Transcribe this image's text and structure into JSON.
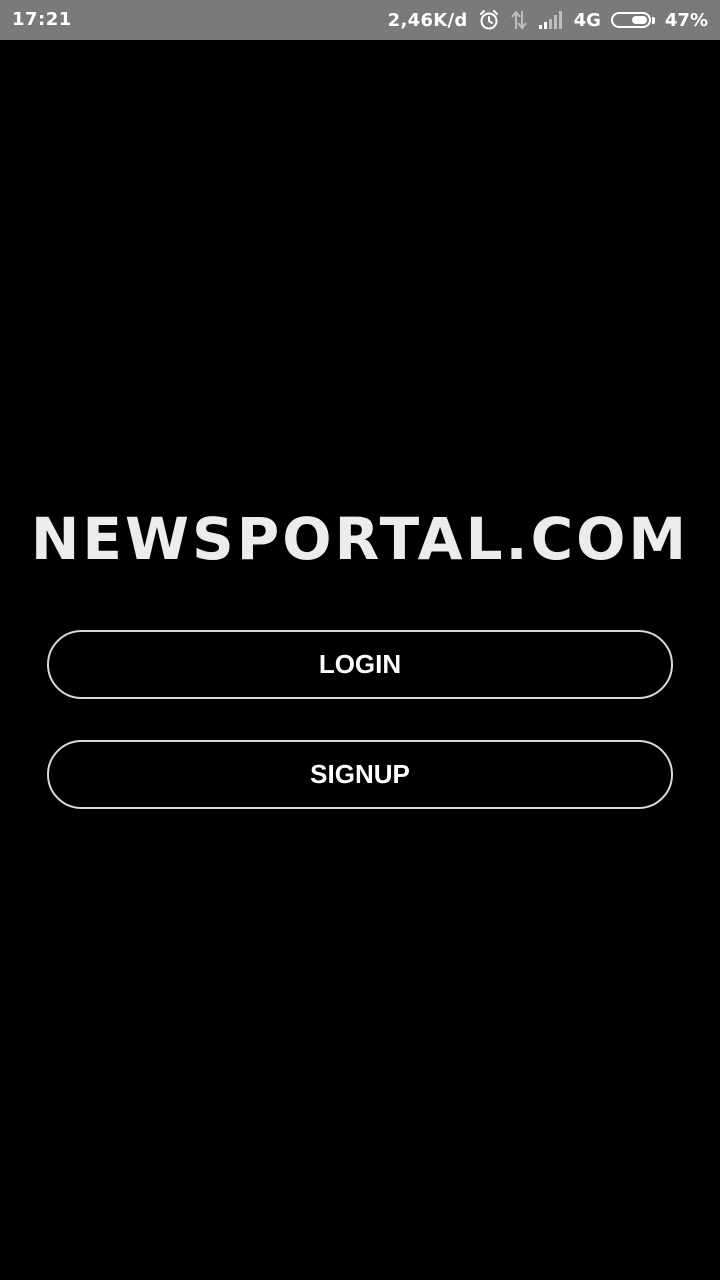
{
  "status_bar": {
    "time": "17:21",
    "data_speed": "2,46K/d",
    "network": "4G",
    "battery_percent": "47%",
    "battery_level": 0.47,
    "icons": [
      "alarm-icon",
      "data-transfer-icon",
      "signal-icon",
      "battery-icon"
    ]
  },
  "logo": {
    "text": "NEWSPORTAL.COM"
  },
  "buttons": {
    "login_label": "LOGIN",
    "signup_label": "SIGNUP"
  },
  "colors": {
    "background": "#000000",
    "status_bar": "#7a7a7a",
    "button_border": "#d9d9d9",
    "text": "#ffffff"
  }
}
